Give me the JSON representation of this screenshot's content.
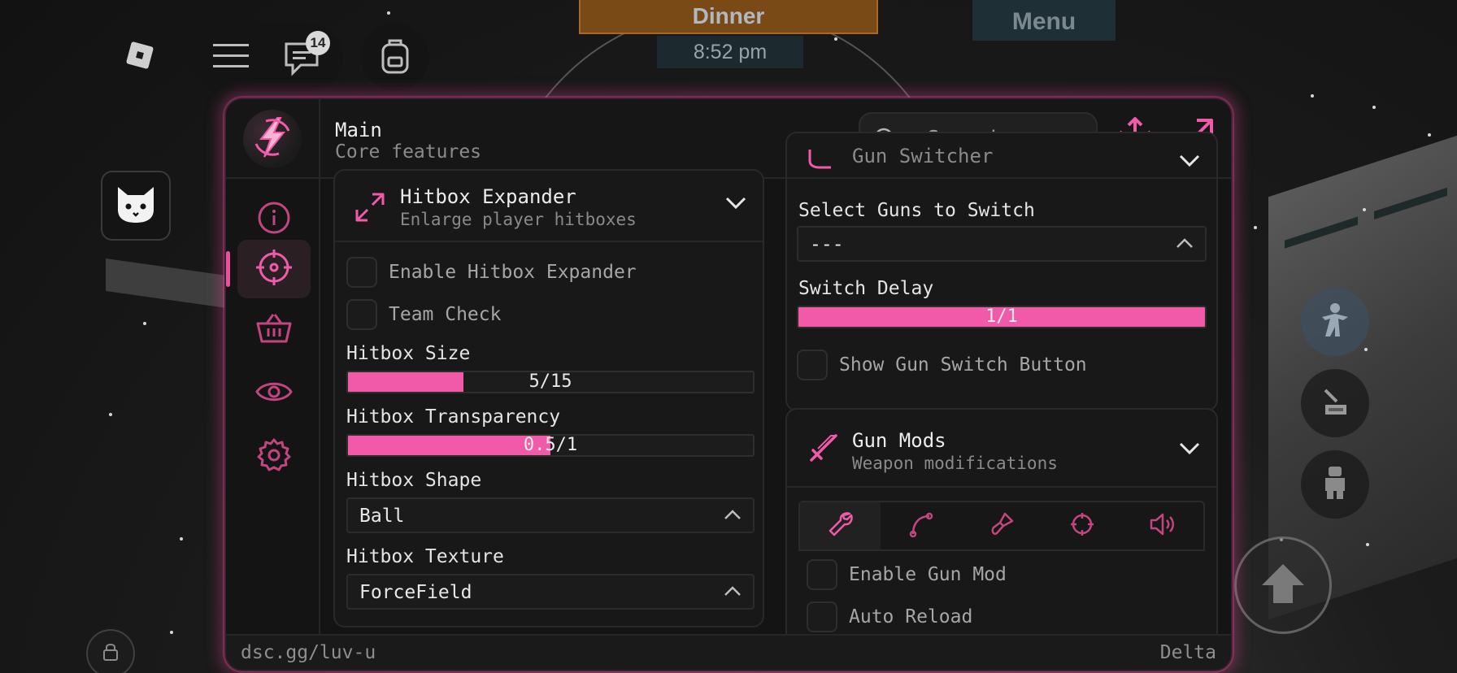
{
  "background": {
    "dinner_sign": "Dinner",
    "clock": "8:52 pm",
    "menu_sign": "Menu"
  },
  "roblox": {
    "chat_badge": "14",
    "icons": [
      "roblox-logo-icon",
      "hamburger-icon",
      "chat-icon",
      "backpack-icon",
      "cat-icon",
      "lock-icon",
      "emote-icon",
      "jump-icon"
    ]
  },
  "header": {
    "title": "Main",
    "subtitle": "Core features",
    "search_placeholder": "Search"
  },
  "sidebar": {
    "items": [
      {
        "icon": "info-icon",
        "active": false
      },
      {
        "icon": "crosshair-icon",
        "active": true
      },
      {
        "icon": "basket-icon",
        "active": false
      },
      {
        "icon": "eye-icon",
        "active": false
      },
      {
        "icon": "gear-icon",
        "active": false
      }
    ]
  },
  "hitbox": {
    "title": "Hitbox Expander",
    "subtitle": "Enlarge player hitboxes",
    "enable_label": "Enable Hitbox Expander",
    "team_check_label": "Team Check",
    "size_label": "Hitbox Size",
    "size_value": "5/15",
    "size_fraction": 0.2857,
    "transparency_label": "Hitbox Transparency",
    "transparency_value": "0.5/1",
    "transparency_fraction": 0.5,
    "shape_label": "Hitbox Shape",
    "shape_value": "Ball",
    "texture_label": "Hitbox Texture",
    "texture_value": "ForceField"
  },
  "gun_switcher": {
    "title": "Gun Switcher",
    "select_label": "Select Guns to Switch",
    "select_value": "---",
    "delay_label": "Switch Delay",
    "delay_value": "1/1",
    "delay_fraction": 1.0,
    "show_button_label": "Show Gun Switch Button"
  },
  "gun_mods": {
    "title": "Gun Mods",
    "subtitle": "Weapon modifications",
    "tabs": [
      "wrench-icon",
      "hook-icon",
      "brush-icon",
      "crosshair-icon",
      "speaker-icon"
    ],
    "enable_label": "Enable Gun Mod",
    "auto_reload_label": "Auto Reload"
  },
  "footer": {
    "left": "dsc.gg/luv-u",
    "right": "Delta"
  },
  "colors": {
    "accent": "#f05aa8",
    "panel": "#141414",
    "glow": "#ec4899"
  }
}
